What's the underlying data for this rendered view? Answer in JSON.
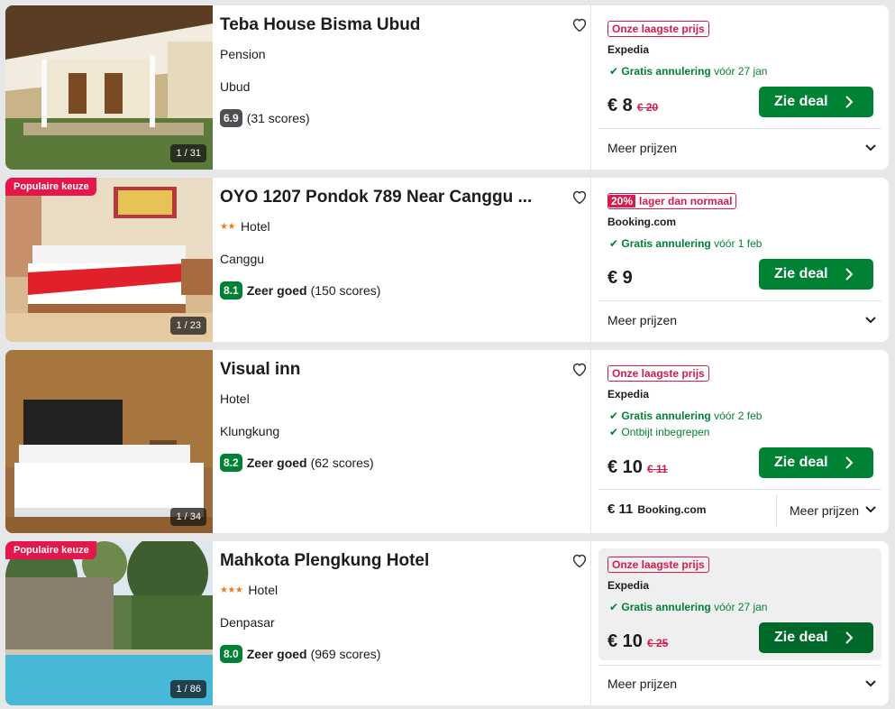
{
  "listings": [
    {
      "title": "Teba House Bisma Ubud",
      "type": "Pension",
      "stars": "",
      "location": "Ubud",
      "score": "6.9",
      "rating_label": "",
      "reviews": "(31 scores)",
      "photo_counter": "1 / 31",
      "popular_badge": "",
      "deal_tag": "Onze laagste prijs",
      "deal_tag_pct": "",
      "provider": "Expedia",
      "cancel_bold": "Gratis annulering",
      "cancel_rest": "vóór 27 jan",
      "extra_perk": "",
      "price": "€ 8",
      "old_price": "€ 20",
      "button": "Zie deal",
      "more_prices": "Meer prijzen"
    },
    {
      "title": "OYO 1207 Pondok 789 Near Canggu ...",
      "type": "Hotel",
      "stars": "★★",
      "location": "Canggu",
      "score": "8.1",
      "rating_label": "Zeer goed",
      "reviews": "(150 scores)",
      "photo_counter": "1 / 23",
      "popular_badge": "Populaire keuze",
      "deal_tag": "lager dan normaal",
      "deal_tag_pct": "20%",
      "provider": "Booking.com",
      "cancel_bold": "Gratis annulering",
      "cancel_rest": "vóór 1 feb",
      "extra_perk": "",
      "price": "€ 9",
      "old_price": "",
      "button": "Zie deal",
      "more_prices": "Meer prijzen"
    },
    {
      "title": "Visual inn",
      "type": "Hotel",
      "stars": "",
      "location": "Klungkung",
      "score": "8.2",
      "rating_label": "Zeer goed",
      "reviews": "(62 scores)",
      "photo_counter": "1 / 34",
      "popular_badge": "",
      "deal_tag": "Onze laagste prijs",
      "deal_tag_pct": "",
      "provider": "Expedia",
      "cancel_bold": "Gratis annulering",
      "cancel_rest": "vóór 2 feb",
      "extra_perk": "Ontbijt inbegrepen",
      "price": "€ 10",
      "old_price": "€ 11",
      "button": "Zie deal",
      "alt_price": "€ 11",
      "alt_provider": "Booking.com",
      "more_prices": "Meer prijzen"
    },
    {
      "title": "Mahkota Plengkung Hotel",
      "type": "Hotel",
      "stars": "★★★",
      "location": "Denpasar",
      "score": "8.0",
      "rating_label": "Zeer goed",
      "reviews": "(969 scores)",
      "photo_counter": "1 / 86",
      "popular_badge": "Populaire keuze",
      "deal_tag": "Onze laagste prijs",
      "deal_tag_pct": "",
      "provider": "Expedia",
      "cancel_bold": "Gratis annulering",
      "cancel_rest": "vóór 27 jan",
      "extra_perk": "",
      "price": "€ 10",
      "old_price": "€ 25",
      "button": "Zie deal",
      "more_prices": "Meer prijzen"
    }
  ],
  "colors": {
    "deal_green": "#008234",
    "price_red": "#d21d4d",
    "popular_pink": "#e3174c",
    "star_orange": "#ef7b1b"
  }
}
